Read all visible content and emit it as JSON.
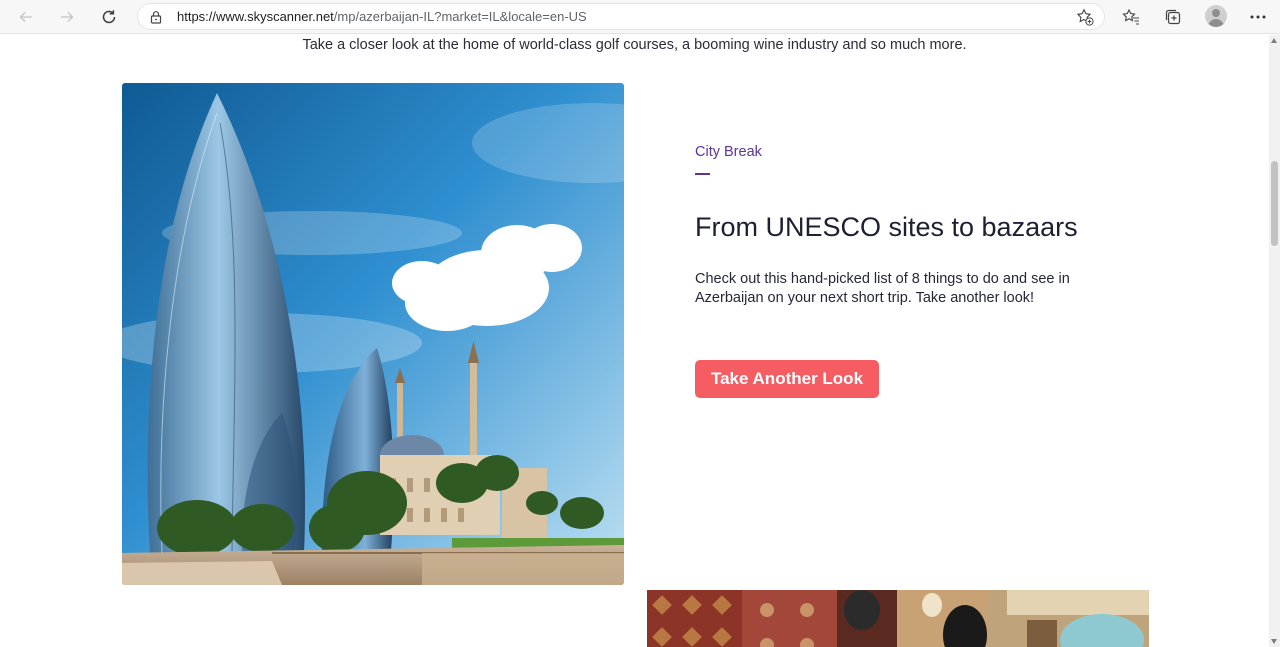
{
  "browser": {
    "url_host": "https://www.skyscanner.net",
    "url_path": "/mp/azerbaijan-IL?market=IL&locale=en-US",
    "icons": [
      "back-arrow-icon",
      "forward-arrow-icon",
      "reload-icon",
      "lock-icon",
      "add-favorite-icon",
      "favorites-icon",
      "collections-icon",
      "profile-avatar",
      "more-options-icon"
    ]
  },
  "intro": {
    "text": "Take a closer look at the home of world-class golf courses, a booming wine industry and so much more."
  },
  "feature": {
    "category": "City Break",
    "headline": "From UNESCO sites to bazaars",
    "description": "Check out this hand-picked list of 8 things to do and see in Azerbaijan on your next short trip. Take another look!",
    "cta_label": "Take Another Look"
  },
  "colors": {
    "accent_purple": "#5b3497",
    "cta_coral": "#f55d62",
    "heading": "#1f1f33"
  }
}
